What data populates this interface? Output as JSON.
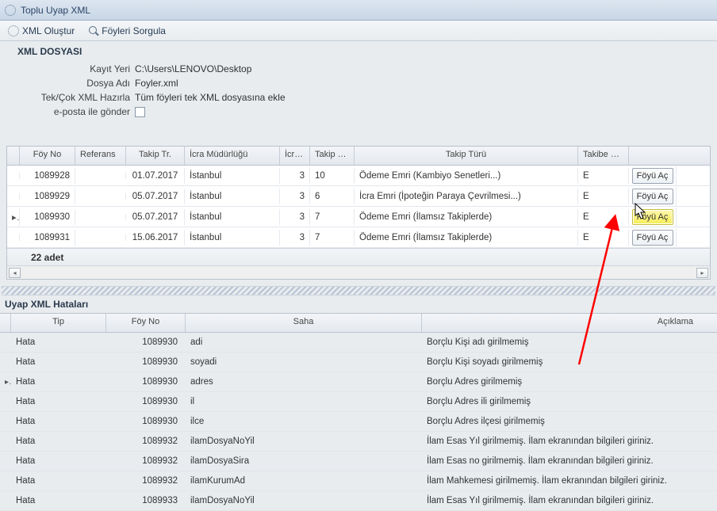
{
  "window": {
    "title": "Toplu Uyap XML"
  },
  "toolbar": {
    "xml_create": "XML Oluştur",
    "query": "Föyleri Sorgula"
  },
  "form": {
    "section": "XML DOSYASI",
    "labels": {
      "kayit_yeri": "Kayıt Yeri",
      "dosya_adi": "Dosya Adı",
      "tekcok": "Tek/Çok XML Hazırla",
      "eposta": "e-posta ile gönder"
    },
    "values": {
      "kayit_yeri": "C:\\Users\\LENOVO\\Desktop",
      "dosya_adi": "Foyler.xml",
      "tekcok": "Tüm föyleri tek XML dosyasına ekle"
    }
  },
  "grid": {
    "headers": {
      "foy_no": "Föy No",
      "referans": "Referans",
      "takip_tr": "Takip Tr.",
      "icra_mud": "İcra Müdürlüğü",
      "icra": "İcra ...",
      "takip_t": "Takip T...",
      "takip_turu": "Takip Türü",
      "takibe_ge": "Takibe Ge..."
    },
    "btn_label": "Föyü Aç",
    "rows": [
      {
        "foy_no": "1089928",
        "referans": "",
        "takip_tr": "01.07.2017",
        "icra_mud": "İstanbul",
        "icra": "3",
        "takip_t": "10",
        "takip_turu": "Ödeme Emri (Kambiyo Senetleri...)",
        "takibe_ge": "E",
        "highlight": false,
        "indicator": ""
      },
      {
        "foy_no": "1089929",
        "referans": "",
        "takip_tr": "05.07.2017",
        "icra_mud": "İstanbul",
        "icra": "3",
        "takip_t": "6",
        "takip_turu": "İcra Emri (İpoteğin Paraya Çevrilmesi...)",
        "takibe_ge": "E",
        "highlight": false,
        "indicator": ""
      },
      {
        "foy_no": "1089930",
        "referans": "",
        "takip_tr": "05.07.2017",
        "icra_mud": "İstanbul",
        "icra": "3",
        "takip_t": "7",
        "takip_turu": "Ödeme Emri (İlamsız Takiplerde)",
        "takibe_ge": "E",
        "highlight": true,
        "indicator": "▸"
      },
      {
        "foy_no": "1089931",
        "referans": "",
        "takip_tr": "15.06.2017",
        "icra_mud": "İstanbul",
        "icra": "3",
        "takip_t": "7",
        "takip_turu": "Ödeme Emri (İlamsız Takiplerde)",
        "takibe_ge": "E",
        "highlight": false,
        "indicator": ""
      }
    ],
    "footer": "22 adet"
  },
  "errors": {
    "title": "Uyap XML Hataları",
    "headers": {
      "tip": "Tip",
      "foy_no": "Föy No",
      "saha": "Saha",
      "aciklama": "Açıklama"
    },
    "rows": [
      {
        "tip": "Hata",
        "foy_no": "1089930",
        "saha": "adi",
        "aciklama": "Borçlu Kişi adı girilmemiş",
        "indicator": ""
      },
      {
        "tip": "Hata",
        "foy_no": "1089930",
        "saha": "soyadi",
        "aciklama": "Borçlu Kişi soyadı girilmemiş",
        "indicator": ""
      },
      {
        "tip": "Hata",
        "foy_no": "1089930",
        "saha": "adres",
        "aciklama": "Borçlu Adres girilmemiş",
        "indicator": "▸"
      },
      {
        "tip": "Hata",
        "foy_no": "1089930",
        "saha": "il",
        "aciklama": "Borçlu Adres ili girilmemiş",
        "indicator": ""
      },
      {
        "tip": "Hata",
        "foy_no": "1089930",
        "saha": "ilce",
        "aciklama": "Borçlu Adres ilçesi girilmemiş",
        "indicator": ""
      },
      {
        "tip": "Hata",
        "foy_no": "1089932",
        "saha": "ilamDosyaNoYil",
        "aciklama": "İlam Esas Yıl girilmemiş. İlam ekranından bilgileri giriniz.",
        "indicator": ""
      },
      {
        "tip": "Hata",
        "foy_no": "1089932",
        "saha": "ilamDosyaSira",
        "aciklama": "İlam Esas no girilmemiş. İlam ekranından bilgileri giriniz.",
        "indicator": ""
      },
      {
        "tip": "Hata",
        "foy_no": "1089932",
        "saha": "ilamKurumAd",
        "aciklama": "İlam Mahkemesi girilmemiş. İlam ekranından bilgileri giriniz.",
        "indicator": ""
      },
      {
        "tip": "Hata",
        "foy_no": "1089933",
        "saha": "ilamDosyaNoYil",
        "aciklama": "İlam Esas Yıl girilmemiş. İlam ekranından bilgileri giriniz.",
        "indicator": ""
      }
    ]
  }
}
